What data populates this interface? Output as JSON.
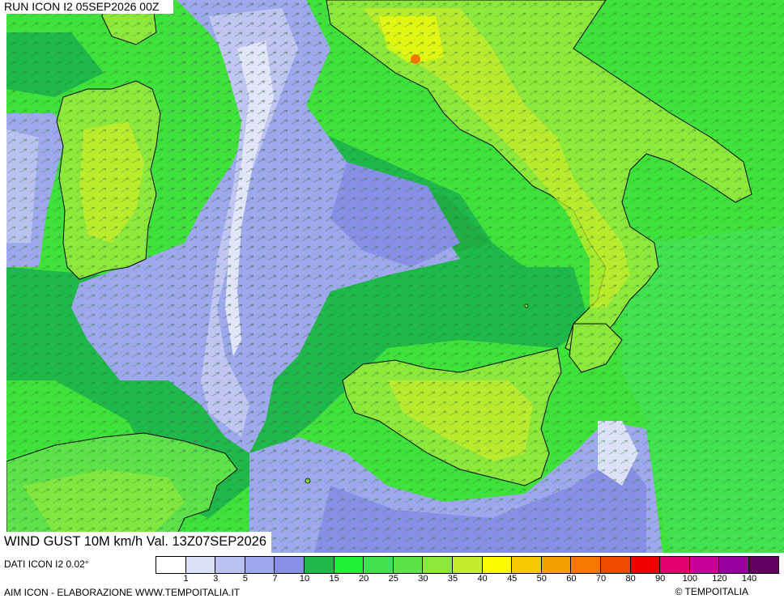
{
  "run_label": "RUN ICON I2 05SEP2026 00Z",
  "title": "WIND GUST 10M km/h Val. 13Z07SEP2026",
  "dati": "DATI ICON I2 0.02°",
  "credit": "AIM ICON - ELABORAZIONE WWW.TEMPOITALIA.IT",
  "copyright": "© TEMPOITALIA",
  "legend": {
    "ticks": [
      "1",
      "3",
      "5",
      "7",
      "10",
      "15",
      "20",
      "25",
      "30",
      "35",
      "40",
      "45",
      "50",
      "60",
      "70",
      "80",
      "90",
      "100",
      "120",
      "140"
    ],
    "colors": [
      "#ffffff",
      "#dce1f7",
      "#b9c1f0",
      "#9ea8ec",
      "#8890e6",
      "#1fb84a",
      "#1ef036",
      "#40e34f",
      "#5ee24a",
      "#8ee83c",
      "#c5ec2a",
      "#fbfb00",
      "#f8c800",
      "#f5a000",
      "#f57800",
      "#f04a00",
      "#f00000",
      "#e6006e",
      "#c8009a",
      "#9600a0",
      "#640064"
    ]
  }
}
